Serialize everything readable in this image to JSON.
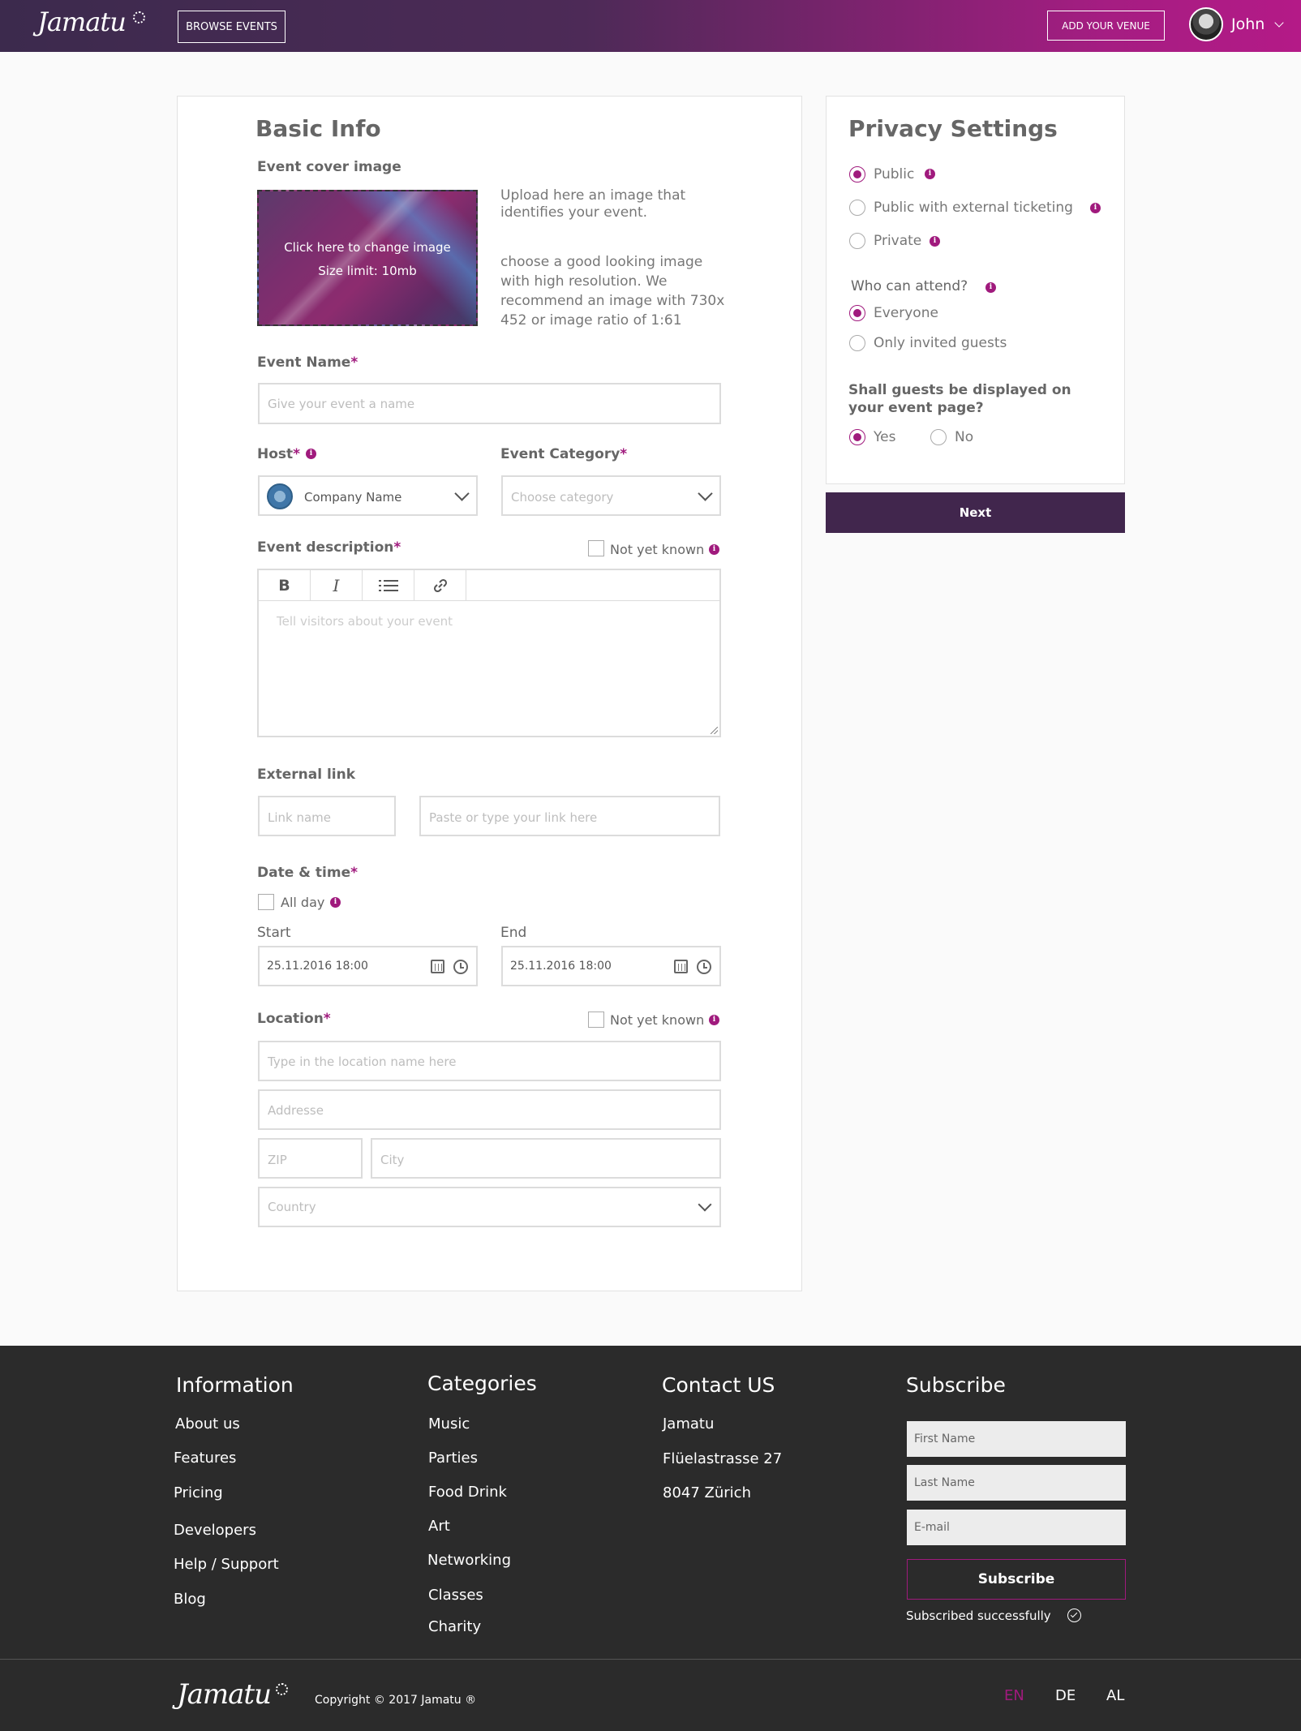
{
  "header": {
    "logo": "Jamatu",
    "browse_label": "BROWSE EVENTS",
    "add_venue_label": "ADD YOUR VENUE",
    "user_name": "John"
  },
  "basic_info": {
    "title": "Basic Info",
    "cover_label": "Event cover image",
    "cover_click": "Click here to change image",
    "cover_size": "Size limit: 10mb",
    "upload_hint_1": "Upload here an image that identifies your event.",
    "upload_hint_2": "choose a good looking image with high resolution. We recommend an image with 730x 452 or image ratio of 1:61",
    "event_name_label": "Event Name",
    "event_name_placeholder": "Give your event a name",
    "host_label": "Host",
    "host_value": "Company Name",
    "category_label": "Event Category",
    "category_placeholder": "Choose category",
    "description_label": "Event description",
    "not_yet_known": "Not yet known",
    "description_placeholder": "Tell visitors about your event",
    "external_link_label": "External link",
    "link_name_placeholder": "Link name",
    "link_url_placeholder": "Paste or type your link here",
    "datetime_label": "Date & time",
    "all_day_label": "All day",
    "start_label": "Start",
    "start_value": "25.11.2016 18:00",
    "end_label": "End",
    "end_value": "25.11.2016 18:00",
    "location_label": "Location",
    "location_not_yet_known": "Not yet known",
    "location_placeholder": "Type in the location name here",
    "address_placeholder": "Addresse",
    "zip_placeholder": "ZIP",
    "city_placeholder": "City",
    "country_placeholder": "Country"
  },
  "privacy": {
    "title": "Privacy Settings",
    "options": [
      "Public",
      "Public with external ticketing",
      "Private"
    ],
    "selected_option": "Public",
    "attend_label": "Who can attend?",
    "attend_options": [
      "Everyone",
      "Only invited guests"
    ],
    "attend_selected": "Everyone",
    "guests_label": "Shall guests be displayed on your event page?",
    "guests_yes": "Yes",
    "guests_no": "No",
    "guests_selected": "Yes",
    "next_label": "Next"
  },
  "footer": {
    "information": {
      "title": "Information",
      "links": [
        "About us",
        "Features",
        "Pricing",
        "Developers",
        "Help / Support",
        "Blog"
      ]
    },
    "categories": {
      "title": "Categories",
      "links": [
        "Music",
        "Parties",
        "Food Drink",
        "Art",
        "Networking",
        "Classes",
        "Charity"
      ]
    },
    "contact": {
      "title": "Contact US",
      "lines": [
        "Jamatu",
        "Flüelastrasse 27",
        "8047 Zürich"
      ]
    },
    "subscribe": {
      "title": "Subscribe",
      "first_name_placeholder": "First Name",
      "last_name_placeholder": "Last Name",
      "email_placeholder": "E-mail",
      "button_label": "Subscribe",
      "status": "Subscribed successfully"
    },
    "logo": "Jamatu",
    "copyright": "Copyright © 2017 Jamatu ®",
    "languages": [
      "EN",
      "DE",
      "AL"
    ],
    "active_language": "EN"
  },
  "colors": {
    "accent": "#a01a7d",
    "dark_purple": "#41264d",
    "footer_bg": "#2b2b2b"
  },
  "icons": [
    "bold-icon",
    "italic-icon",
    "list-icon",
    "link-icon",
    "calendar-icon",
    "clock-icon",
    "chevron-down-icon",
    "info-icon",
    "check-circle-icon"
  ]
}
